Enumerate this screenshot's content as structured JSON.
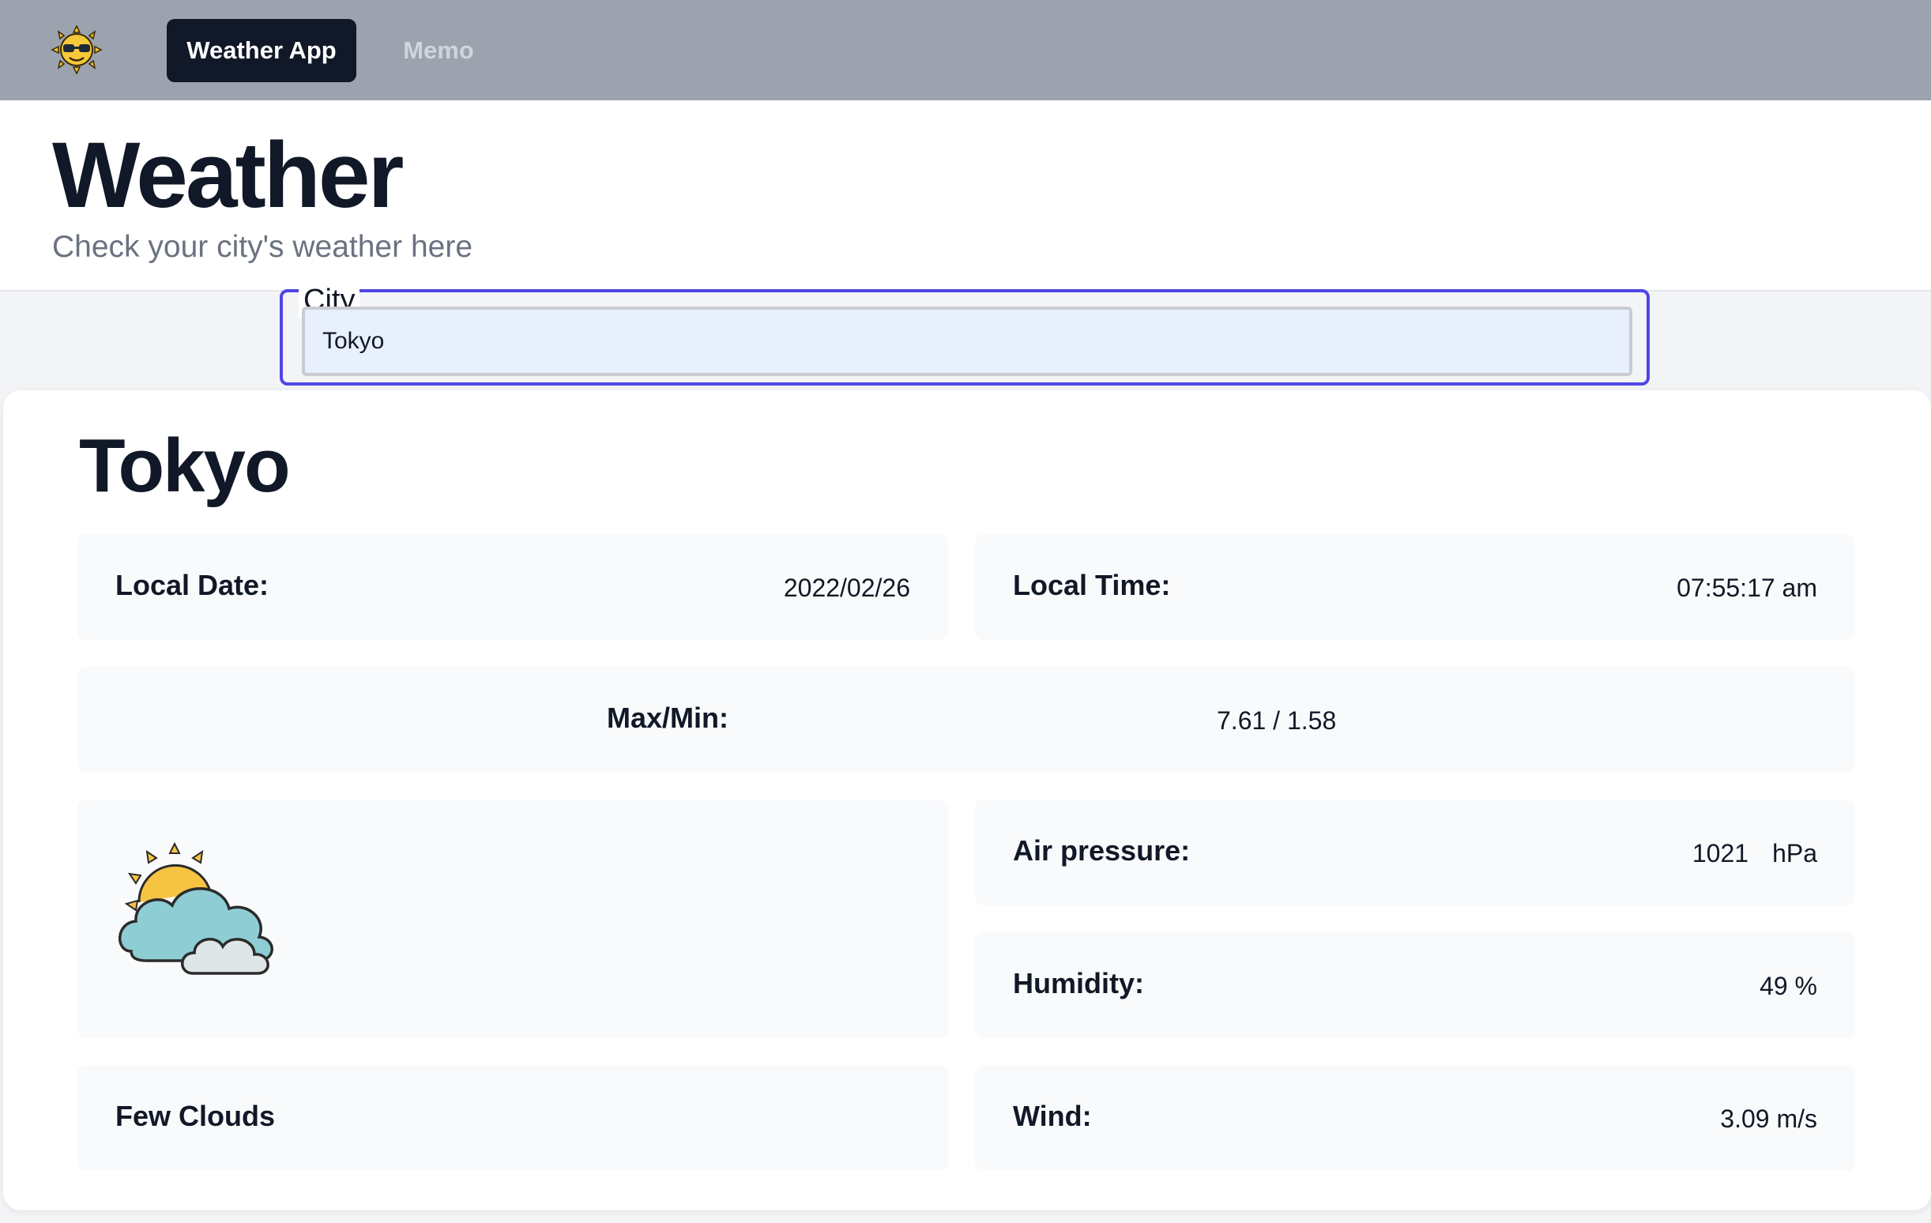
{
  "nav": {
    "logo_icon": "sun-with-sunglasses-icon",
    "active_tab": "Weather App",
    "inactive_tab": "Memo"
  },
  "header": {
    "title": "Weather",
    "subtitle": "Check your city's weather here"
  },
  "search": {
    "legend": "City",
    "value": "Tokyo"
  },
  "weather": {
    "city": "Tokyo",
    "local_date_label": "Local Date:",
    "local_date_value": "2022/02/26",
    "local_time_label": "Local Time:",
    "local_time_value": "07:55:17 am",
    "maxmin_label": "Max/Min:",
    "maxmin_value": "7.61 / 1.58",
    "condition_icon": "few-clouds-icon",
    "condition": "Few Clouds",
    "air_pressure_label": "Air pressure:",
    "air_pressure_value": "1021",
    "air_pressure_unit": "hPa",
    "humidity_label": "Humidity:",
    "humidity_value": "49 %",
    "wind_label": "Wind:",
    "wind_value": "3.09 m/s"
  },
  "colors": {
    "nav_bg": "#9ca3af",
    "active_tab_bg": "#111827",
    "focus_border": "#4f46e5",
    "input_bg": "#e8f0fe"
  }
}
